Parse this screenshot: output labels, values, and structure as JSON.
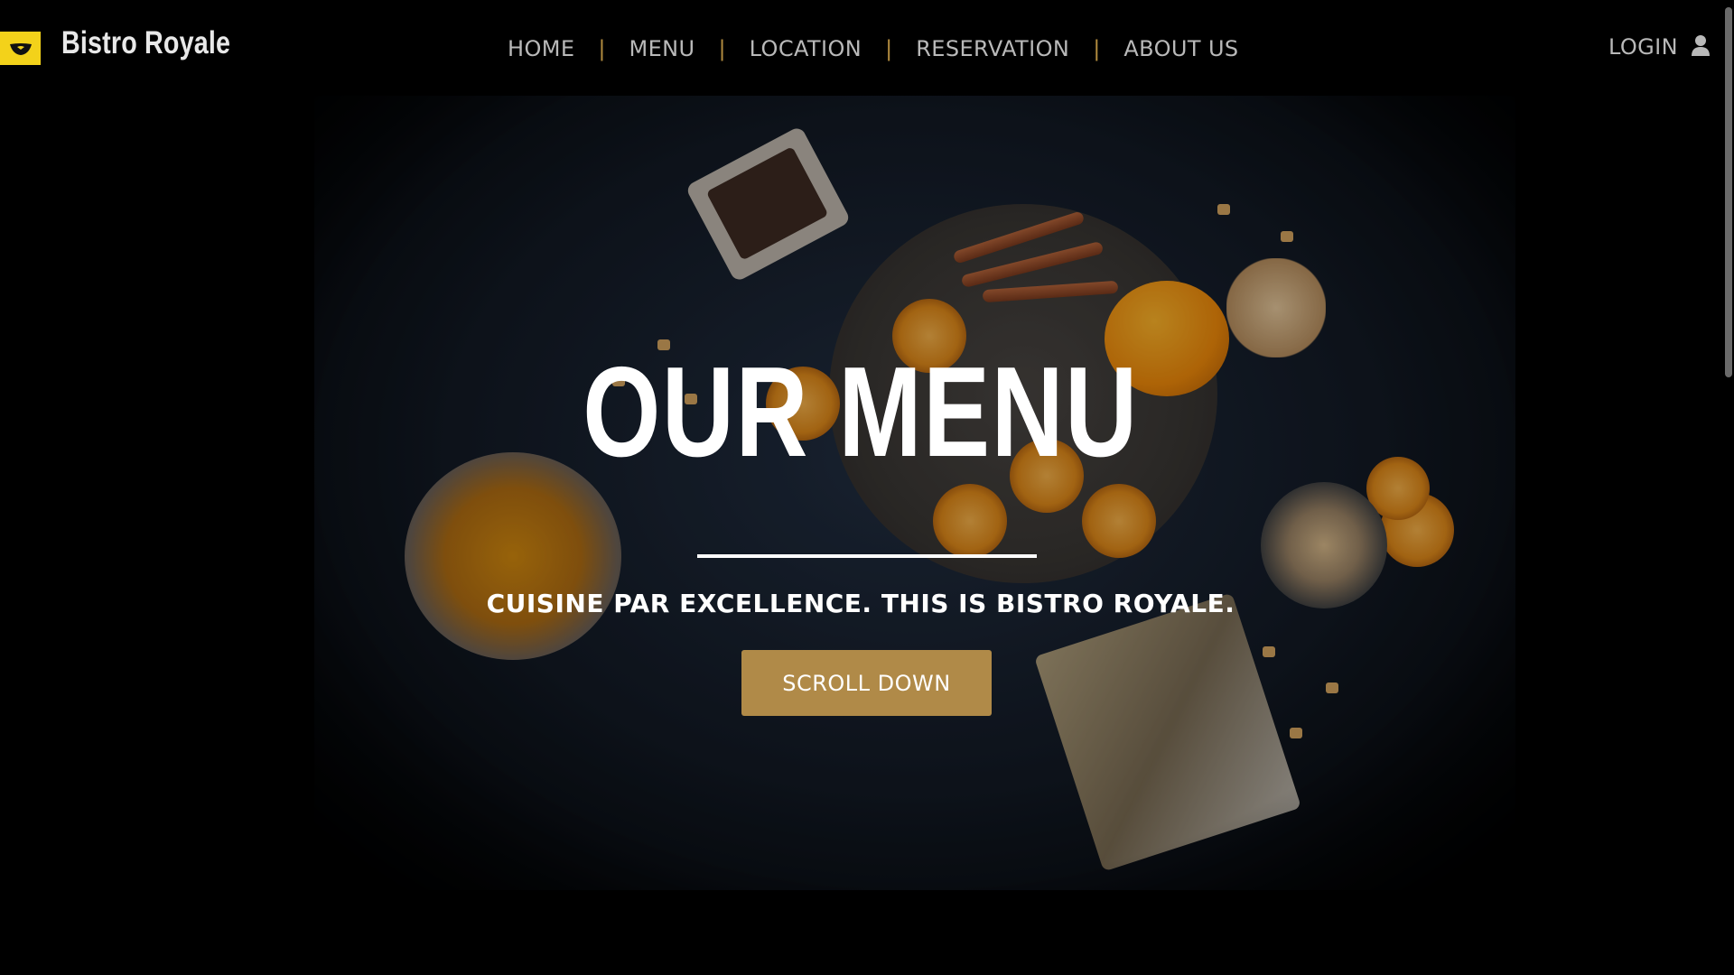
{
  "header": {
    "brand": "Bistro Royale",
    "logo_icon": "bistro-logo-icon",
    "nav": [
      {
        "label": "HOME"
      },
      {
        "label": "MENU"
      },
      {
        "label": "LOCATION"
      },
      {
        "label": "RESERVATION"
      },
      {
        "label": "ABOUT US"
      }
    ],
    "separator": "|",
    "login_label": "LOGIN",
    "login_icon": "user-icon"
  },
  "hero": {
    "title": "OUR MENU",
    "subtitle": "CUISINE PAR EXCELLENCE. THIS IS BISTRO ROYALE.",
    "cta_label": "SCROLL DOWN"
  },
  "colors": {
    "accent": "#b08a48",
    "logo": "#f3d21a",
    "nav_text": "#b9b9b9",
    "background": "#000000"
  }
}
